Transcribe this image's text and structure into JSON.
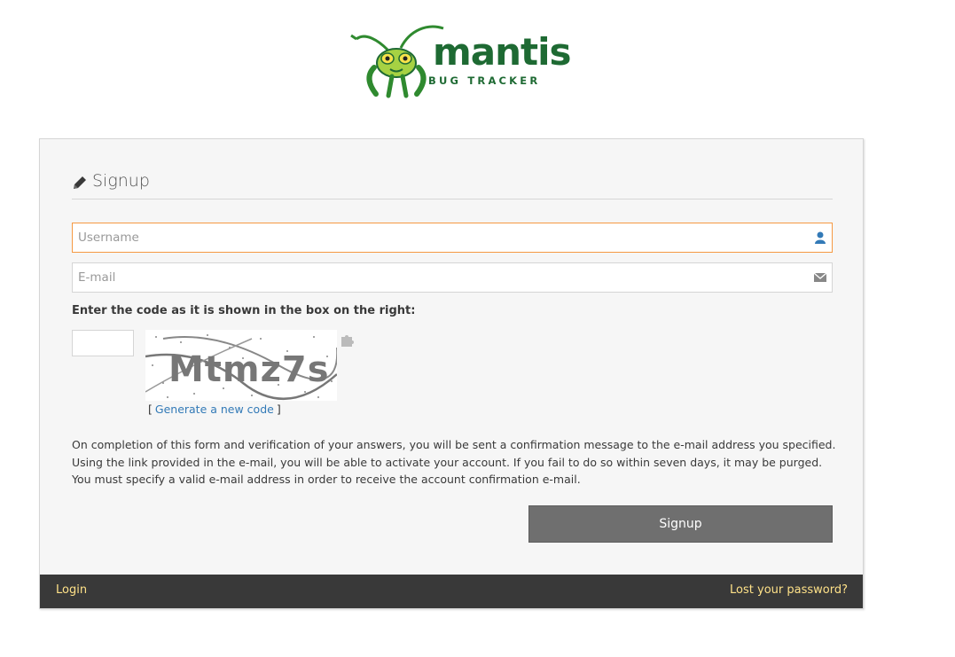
{
  "logo": {
    "wordmark": "mantis",
    "subtitle": "BUG TRACKER",
    "icon": "mantis-mascot-icon",
    "color": "#1e6a33"
  },
  "form": {
    "title": "Signup",
    "title_icon": "pencil-icon",
    "username": {
      "placeholder": "Username",
      "value": "",
      "icon": "user-icon"
    },
    "email": {
      "placeholder": "E-mail",
      "value": "",
      "icon": "envelope-icon"
    },
    "captcha_label": "Enter the code as it is shown in the box on the right:",
    "captcha_text": "Mtmz7s",
    "captcha_icon": "puzzle-icon",
    "regen_open": "[",
    "regen_link": "Generate a new code",
    "regen_close": "]",
    "info_lines": [
      "On completion of this form and verification of your answers, you will be sent a confirmation message to the e-mail address you specified.",
      "Using the link provided in the e-mail, you will be able to activate your account. If you fail to do so within seven days, it may be purged.",
      "You must specify a valid e-mail address in order to receive the account confirmation e-mail."
    ],
    "submit_label": "Signup"
  },
  "footer": {
    "login_label": "Login",
    "lost_password_label": "Lost your password?"
  },
  "colors": {
    "focus_border": "#f59942",
    "button_bg": "#6f6f6f",
    "footer_bg": "#393939",
    "footer_link": "#fee188",
    "link": "#337ab7"
  }
}
